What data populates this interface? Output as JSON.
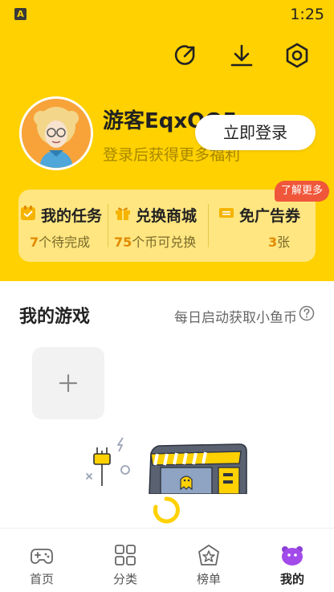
{
  "status_bar": {
    "app_icon_letter": "A",
    "time": "1:25"
  },
  "profile": {
    "username": "游客EqxQQ5",
    "subtitle": "登录后获得更多福利",
    "login_label": "立即登录"
  },
  "stats": {
    "badge": "了解更多",
    "items": [
      {
        "icon": "task-icon",
        "title": "我的任务",
        "value": "7",
        "suffix": "个待完成"
      },
      {
        "icon": "gift-icon",
        "title": "兑换商城",
        "value": "75",
        "suffix": "个币可兑换"
      },
      {
        "icon": "ticket-icon",
        "title": "免广告券",
        "value": "3",
        "suffix": "张"
      }
    ]
  },
  "games": {
    "title": "我的游戏",
    "hint": "每日启动获取小鱼币"
  },
  "tabs": [
    {
      "icon": "gamepad-icon",
      "label": "首页"
    },
    {
      "icon": "grid-icon",
      "label": "分类"
    },
    {
      "icon": "star-badge-icon",
      "label": "榜单"
    },
    {
      "icon": "mascot-icon",
      "label": "我的"
    }
  ],
  "colors": {
    "brand": "#FFD100",
    "accent": "#E28A00",
    "badge": "#F0573A",
    "active_tab": "#A24BEA"
  }
}
